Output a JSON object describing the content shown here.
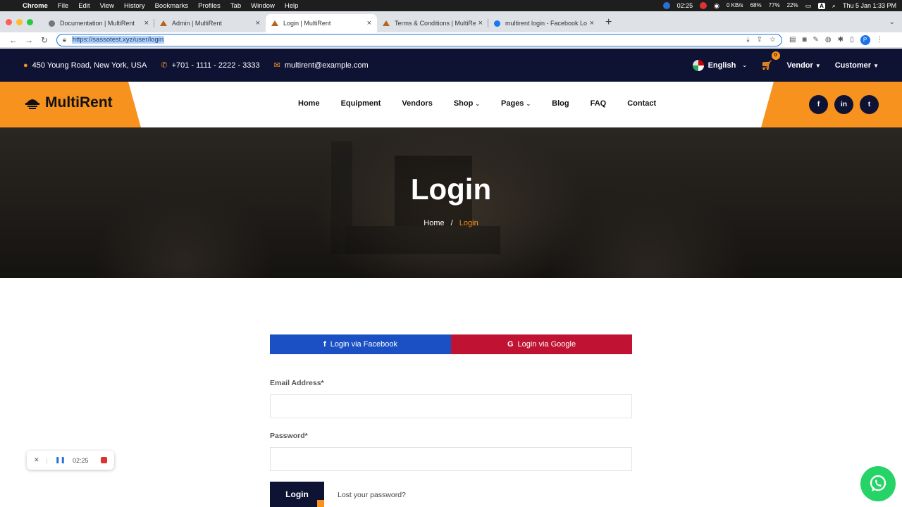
{
  "macos": {
    "app": "Chrome",
    "menus": [
      "File",
      "Edit",
      "View",
      "History",
      "Bookmarks",
      "Profiles",
      "Tab",
      "Window",
      "Help"
    ],
    "rec_time": "02:25",
    "net": "0 KB/s",
    "ssd": "68%",
    "ram": "77%",
    "cpu": "22%",
    "clock": "Thu 5 Jan  1:33 PM"
  },
  "tabs": [
    {
      "title": "Documentation | MultiRent",
      "active": false
    },
    {
      "title": "Admin | MultiRent",
      "active": false
    },
    {
      "title": "Login | MultiRent",
      "active": true
    },
    {
      "title": "Terms & Conditions | MultiRent",
      "active": false
    },
    {
      "title": "multirent login - Facebook Log",
      "active": false
    }
  ],
  "address": {
    "url": "https://sassotest.xyz/user/login"
  },
  "topbar": {
    "address": "450 Young Road, New York, USA",
    "phone": "+701 - 1111 - 2222 - 3333",
    "email": "multirent@example.com",
    "language": "English",
    "cart_count": "0",
    "vendor": "Vendor",
    "customer": "Customer"
  },
  "header": {
    "logo": "MultiRent",
    "nav": [
      "Home",
      "Equipment",
      "Vendors",
      "Shop",
      "Pages",
      "Blog",
      "FAQ",
      "Contact"
    ],
    "social": [
      "f",
      "in",
      "t"
    ]
  },
  "hero": {
    "title": "Login",
    "crumb_home": "Home",
    "crumb_sep": "/",
    "crumb_current": "Login"
  },
  "form": {
    "facebook_label": "Login via Facebook",
    "google_label": "Login via Google",
    "email_label": "Email Address*",
    "password_label": "Password*",
    "email_value": "",
    "password_value": "",
    "login_label": "Login",
    "lost_label": "Lost your password?"
  },
  "recorder": {
    "time": "02:25"
  },
  "colors": {
    "accent": "#f7921e",
    "navy": "#0f1333",
    "facebook": "#1a50c4",
    "google": "#c01232",
    "whatsapp": "#25d366"
  }
}
